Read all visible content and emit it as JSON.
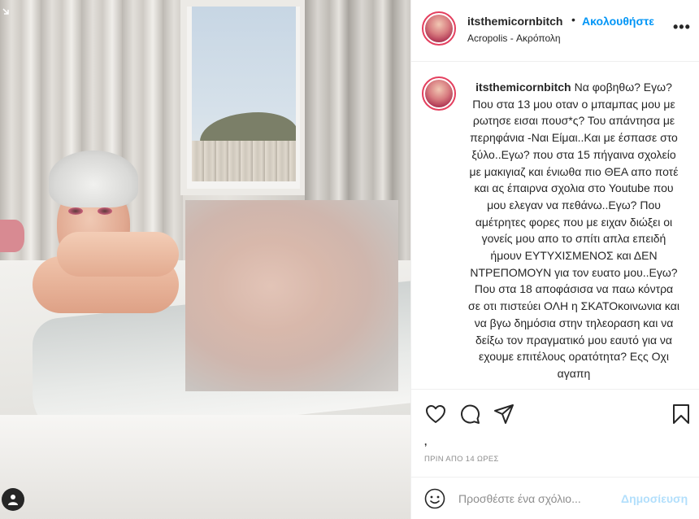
{
  "post": {
    "username": "itsthemicornbitch",
    "follow_label": "Ακολουθήστε",
    "separator": "•",
    "location": "Acropolis - Ακρόπολη",
    "more_label": "•••",
    "caption": "Να φοβηθω? Εγω? Που στα 13 μου οταν ο μπαμπας μου με ρωτησε εισαι πουσ*ς? Του απάντησα με περηφάνια -Ναι Είμαι..Και με έσπασε στο ξύλο..Εγω? που στα 15 πήγαινα σχολείο με μακιγιαζ και ένιωθα πιο ΘΕΑ απο ποτέ και ας έπαιρνα σχολια στο Youtube που μου ελεγαν να πεθάνω..Εγω? Που αμέτρητες φορες που με ειχαν διώξει οι γονείς μου απο το σπίτι απλα επειδή ήμουν ΕΥΤΥΧΙΣΜΕΝΟΣ και ΔΕΝ ΝΤΡΕΠΟΜΟΥΝ για τον ευατο μου..Εγω? Που στα 18 αποφάσισα να παω κόντρα σε οτι πιστεύει ΟΛΗ η ΣΚΑΤΟκοινωνια και να βγω δημόσια στην τηλεοραση και να δείξω τον πραγματικό μου εαυτό για να εχουμε επιτέλους ορατότητα? Εςς Οχι αγαπη",
    "likes_label": ",",
    "timestamp": "ΠΡΙΝ ΑΠΟ 14 ΩΡΕΣ"
  },
  "composer": {
    "placeholder": "Προσθέστε ένα σχόλιο...",
    "publish_label": "Δημοσίευση"
  },
  "colors": {
    "accent": "#0095f6",
    "publish_disabled": "#b2dffc",
    "text": "#262626",
    "muted": "#8e8e8e"
  },
  "icons": [
    "heart-icon",
    "comment-icon",
    "share-icon",
    "bookmark-icon",
    "emoji-icon",
    "user-tag-icon",
    "carousel-arrow-icon"
  ]
}
